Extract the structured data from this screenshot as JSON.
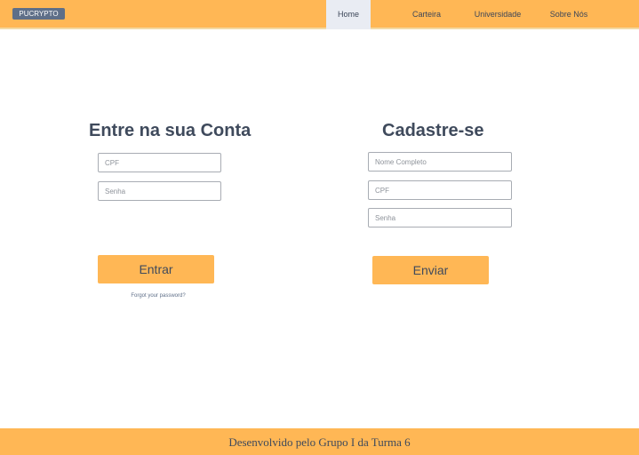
{
  "navbar": {
    "brand": "PUCRYPTO",
    "links": [
      {
        "label": "Home",
        "active": true
      },
      {
        "label": "Carteira",
        "active": false
      },
      {
        "label": "Universidade",
        "active": false
      },
      {
        "label": "Sobre Nós",
        "active": false
      }
    ]
  },
  "login": {
    "title": "Entre na sua Conta",
    "cpf_placeholder": "CPF",
    "senha_placeholder": "Senha",
    "submit_label": "Entrar",
    "forgot_label": "Forgot your password?"
  },
  "signup": {
    "title": "Cadastre-se",
    "nome_placeholder": "Nome Completo",
    "cpf_placeholder": "CPF",
    "senha_placeholder": "Senha",
    "submit_label": "Enviar"
  },
  "footer": {
    "text": "Desenvolvido pelo Grupo I da Turma 6"
  },
  "colors": {
    "accent": "#ffb755",
    "brand_badge": "#5f6f88",
    "active_tab": "#e9ecf3",
    "text": "#3f4a5c"
  }
}
